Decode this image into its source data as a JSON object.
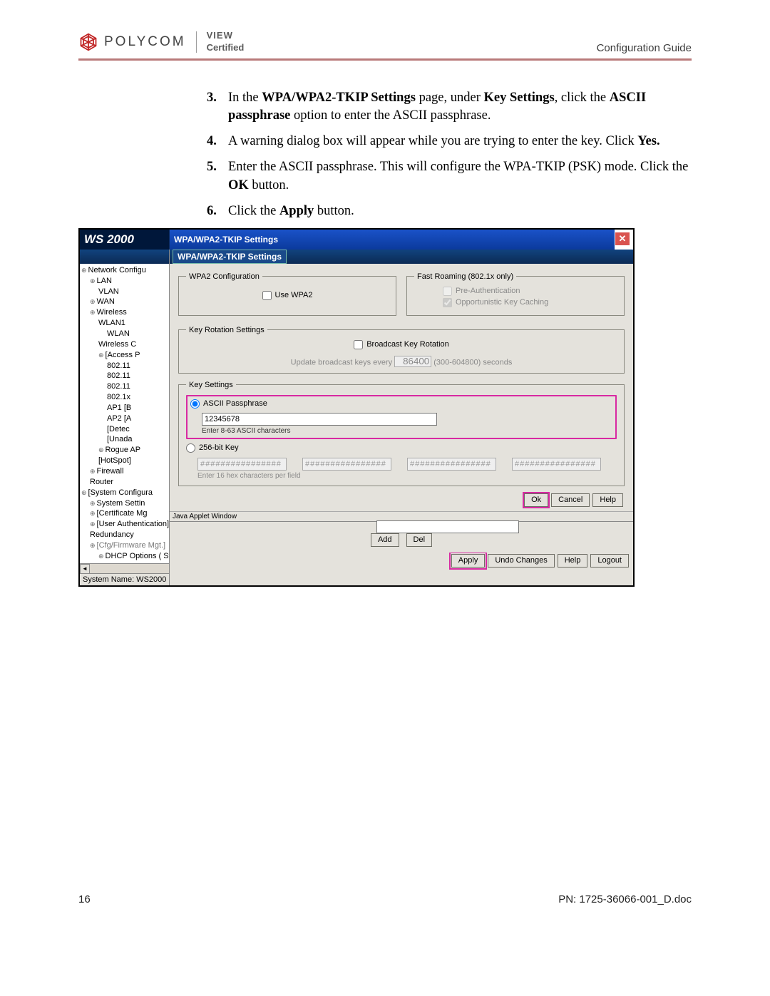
{
  "header": {
    "brand": "POLYCOM",
    "view": "VIEW",
    "certified": "Certified",
    "right": "Configuration Guide"
  },
  "steps": {
    "s3": {
      "num": "3.",
      "pre": "In the ",
      "b1": "WPA/WPA2-TKIP Settings",
      "mid1": " page, under ",
      "b2": "Key Settings",
      "mid2": ", click the ",
      "b3": "ASCII passphrase",
      "tail": " option to enter the ASCII passphrase."
    },
    "s4": {
      "num": "4.",
      "text": "A warning dialog box will appear while you are trying to enter the key. Click ",
      "bold": "Yes."
    },
    "s5": {
      "num": "5.",
      "text": "Enter the ASCII passphrase. This will configure the WPA-TKIP (PSK) mode. Click the ",
      "bold": "OK",
      "tail": " button."
    },
    "s6": {
      "num": "6.",
      "text": "Click the ",
      "bold": "Apply",
      "tail": " button."
    }
  },
  "shot": {
    "ws2000": "WS 2000",
    "dialog_title": "WPA/WPA2-TKIP Settings",
    "close": "✕",
    "panel_title": "WPA/WPA2-TKIP Settings",
    "tree": [
      {
        "cls": "tnode hand",
        "label": "Network Configu"
      },
      {
        "cls": "in1 hand",
        "label": "LAN"
      },
      {
        "cls": "in2",
        "label": "VLAN"
      },
      {
        "cls": "in1 hand",
        "label": "WAN"
      },
      {
        "cls": "in1 hand",
        "label": "Wireless"
      },
      {
        "cls": "in2",
        "label": "WLAN1"
      },
      {
        "cls": "in3",
        "label": "WLAN"
      },
      {
        "cls": "in2",
        "label": "Wireless C"
      },
      {
        "cls": "in2 hand",
        "label": "[Access P"
      },
      {
        "cls": "in3",
        "label": "802.11"
      },
      {
        "cls": "in3",
        "label": "802.11"
      },
      {
        "cls": "in3",
        "label": "802.11"
      },
      {
        "cls": "in3",
        "label": "802.1x"
      },
      {
        "cls": "in3",
        "label": "AP1 [B"
      },
      {
        "cls": "in3",
        "label": "AP2 [A"
      },
      {
        "cls": "in3",
        "label": "[Detec"
      },
      {
        "cls": "in3",
        "label": "[Unada"
      },
      {
        "cls": "in2 hand",
        "label": "Rogue AP"
      },
      {
        "cls": "in2",
        "label": "[HotSpot]"
      },
      {
        "cls": "in1 hand",
        "label": "Firewall"
      },
      {
        "cls": "in1",
        "label": "Router"
      },
      {
        "cls": "tnode hand",
        "label": "[System Configura"
      },
      {
        "cls": "in1 hand",
        "label": "System Settin"
      },
      {
        "cls": "in1 hand",
        "label": "[Certificate Mg"
      },
      {
        "cls": "in1 hand",
        "label": "[User Authentication]"
      },
      {
        "cls": "in1",
        "label": "Redundancy"
      },
      {
        "cls": "in1 hand gray",
        "label": "[Cfg/Firmware Mgt.]"
      },
      {
        "cls": "in2 hand",
        "label": "DHCP Options ( Sys"
      }
    ],
    "wpa2_legend": "WPA2 Configuration",
    "use_wpa2": "Use WPA2",
    "fast_legend": "Fast Roaming (802.1x only)",
    "preauth": "Pre-Authentication",
    "oppcache": "Opportunistic Key Caching",
    "rot_legend": "Key Rotation Settings",
    "rot_chk": "Broadcast Key Rotation",
    "rot_lbl": "Update broadcast keys every",
    "rot_val": "86400",
    "rot_hint": "(300-604800) seconds",
    "key_legend": "Key Settings",
    "ascii_radio": "ASCII Passphrase",
    "ascii_value": "12345678",
    "ascii_hint": "Enter 8-63 ASCII characters",
    "bitkey_radio": "256-bit Key",
    "hex_mask": "################",
    "hex_hint": "Enter 16 hex characters per field",
    "ok": "Ok",
    "cancel": "Cancel",
    "help": "Help",
    "applet": "Java Applet Window",
    "add": "Add",
    "del": "Del",
    "apply": "Apply",
    "undo": "Undo Changes",
    "help2": "Help",
    "logout": "Logout",
    "status": "System Name: WS2000"
  },
  "footer": {
    "left": "16",
    "right": "PN: 1725-36066-001_D.doc"
  }
}
